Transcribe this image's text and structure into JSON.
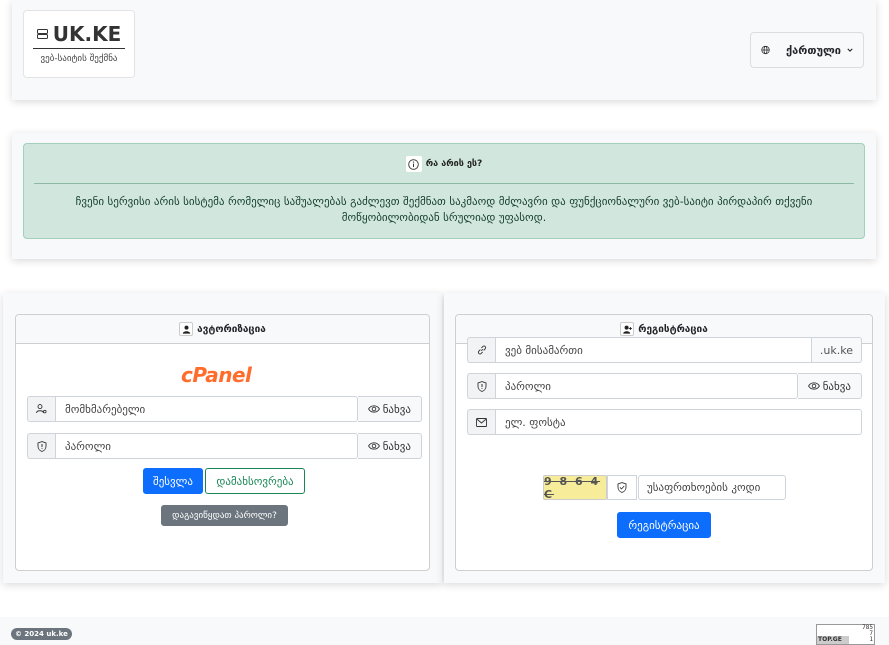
{
  "header": {
    "logo_text": "UK.KE",
    "logo_subtitle": "ვებ-საიტის შექმნა",
    "language_label": "ქართული"
  },
  "info": {
    "title": "რა არის ეს?",
    "text": "ჩვენი სერვისი არის სისტემა რომელიც საშუალებას გაძლევთ შექმნათ საკმაოდ მძლავრი და ფუნქციონალური ვებ-საიტი პირდაპირ თქვენი მოწყობილობიდან სრულიად უფასოდ."
  },
  "login": {
    "title": "ავტორიზაცია",
    "logo_text": "cPanel",
    "username_placeholder": "მომხმარებელი",
    "password_placeholder": "პაროლი",
    "show_label": "ნახვა",
    "submit_label": "შესვლა",
    "remember_label": "დამახსოვრება",
    "forgot_label": "დაგავიწყდათ პაროლი?"
  },
  "register": {
    "title": "რეგისტრაცია",
    "website_placeholder": "ვებ მისამართი",
    "domain_suffix": ".uk.ke",
    "password_placeholder": "პაროლი",
    "show_label": "ნახვა",
    "email_placeholder": "ელ. ფოსტა",
    "captcha_text": "9 8 6 4 C",
    "captcha_placeholder": "უსაფრთხოების კოდი",
    "submit_label": "რეგისტრაცია"
  },
  "footer": {
    "copyright": "© 2024 uk.ke",
    "counter_values": [
      "785",
      "7",
      "1"
    ],
    "counter_brand": "TOP.GE"
  },
  "colors": {
    "primary": "#0d6efd",
    "success": "#198754",
    "alert_bg": "#d1e7dd",
    "cpanel": "#ff6c2c"
  }
}
